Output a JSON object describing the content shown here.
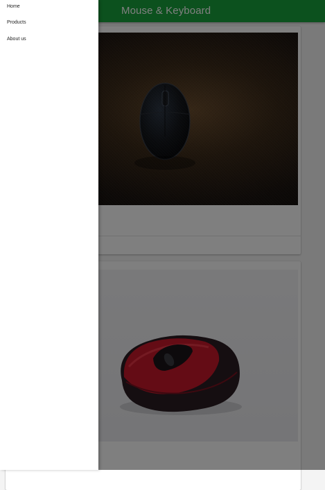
{
  "appbar": {
    "title": "Mouse & Keyboard",
    "color": "#19a33d"
  },
  "drawer": {
    "items": [
      {
        "label": "Home"
      },
      {
        "label": "Products"
      },
      {
        "label": "About us"
      }
    ]
  },
  "products": [
    {
      "image": "dark-wireless-mouse-photo"
    },
    {
      "image": "red-wireless-mouse-photo"
    }
  ],
  "scrim_color": "rgba(0,0,0,0.5)"
}
